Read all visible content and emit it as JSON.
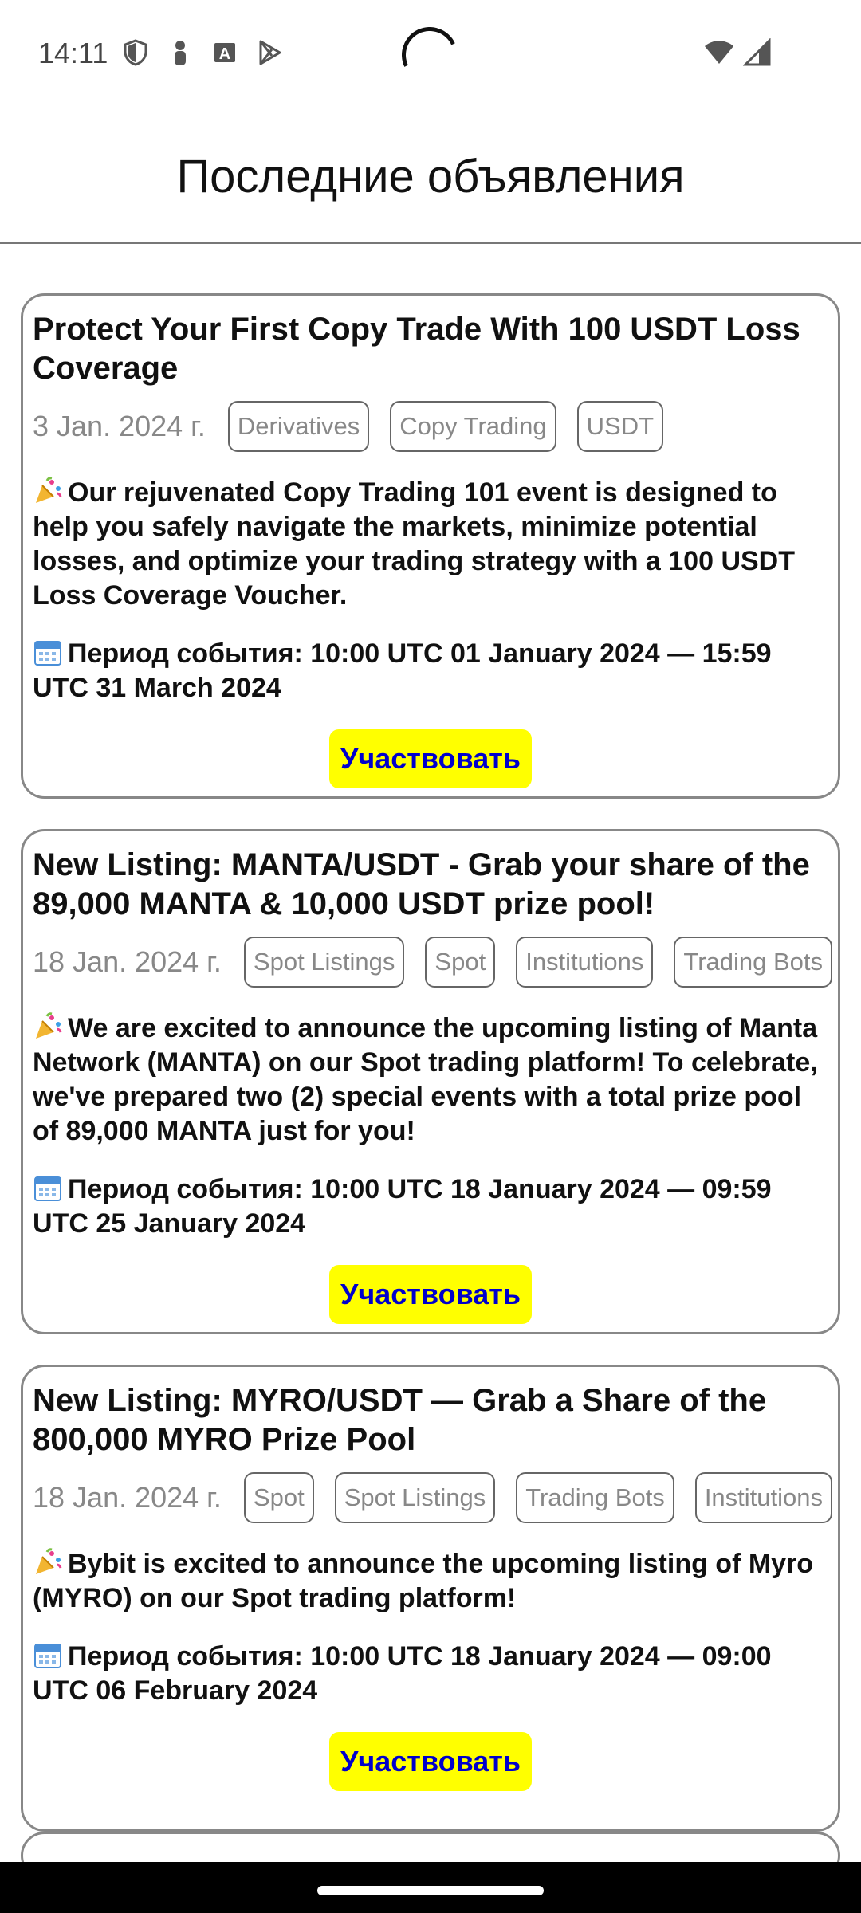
{
  "status_bar": {
    "time": "14:11",
    "icons_left": [
      "shield-icon",
      "person-icon",
      "text-a-icon",
      "play-store-icon"
    ],
    "icons_right": [
      "wifi-icon",
      "signal-icon"
    ]
  },
  "header": {
    "title": "Последние объявления"
  },
  "announcements": [
    {
      "title": "Protect Your First Copy Trade With 100 USDT Loss Coverage",
      "date": "3 Jan. 2024 г.",
      "tags": [
        "Derivatives",
        "Copy Trading",
        "USDT"
      ],
      "description": "Our rejuvenated Copy Trading 101 event is designed to help you safely navigate the markets, minimize potential losses, and optimize your trading strategy with a 100 USDT Loss Coverage Voucher.",
      "period": "Период события: 10:00 UTC 01 January 2024 — 15:59 UTC 31 March 2024",
      "button_label": "Участвовать"
    },
    {
      "title": "New Listing: MANTA/USDT - Grab your share of the 89,000 MANTA & 10,000 USDT prize pool!",
      "date": "18 Jan. 2024 г.",
      "tags": [
        "Spot Listings",
        "Spot",
        "Institutions",
        "Trading Bots"
      ],
      "description": "We are excited to announce the upcoming listing of Manta Network (MANTA) on our Spot trading platform! To celebrate, we've prepared two (2) special events with a total prize pool of 89,000 MANTA just for you!",
      "period": "Период события: 10:00 UTC 18 January 2024 — 09:59 UTC 25 January 2024",
      "button_label": "Участвовать"
    },
    {
      "title": "New Listing: MYRO/USDT — Grab a Share of the 800,000 MYRO Prize Pool",
      "date": "18 Jan. 2024 г.",
      "tags": [
        "Spot",
        "Spot Listings",
        "Trading Bots",
        "Institutions"
      ],
      "description": "Bybit is excited to announce the upcoming listing of Myro (MYRO) on our Spot trading platform!",
      "period": "Период события: 10:00 UTC 18 January 2024 — 09:00 UTC 06 February 2024",
      "button_label": "Участвовать"
    }
  ],
  "colors": {
    "button_bg": "#ffff00",
    "button_text": "#0000cc",
    "card_border": "#888888",
    "muted_text": "#888888"
  }
}
